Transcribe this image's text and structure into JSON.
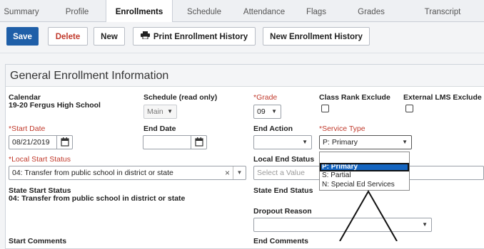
{
  "tabs": [
    {
      "label": "Summary",
      "active": false
    },
    {
      "label": "Profile",
      "active": false
    },
    {
      "label": "Enrollments",
      "active": true
    },
    {
      "label": "Schedule",
      "active": false
    },
    {
      "label": "Attendance",
      "active": false
    },
    {
      "label": "Flags",
      "active": false
    },
    {
      "label": "Grades",
      "active": false
    },
    {
      "label": "Transcript",
      "active": false
    }
  ],
  "toolbar": {
    "save": "Save",
    "delete": "Delete",
    "new": "New",
    "print": "Print Enrollment History",
    "new_history": "New Enrollment History"
  },
  "panel": {
    "title": "General Enrollment Information",
    "calendar": {
      "label": "Calendar",
      "value": "19-20 Fergus High School"
    },
    "schedule": {
      "label": "Schedule (read only)",
      "value": "Main"
    },
    "grade": {
      "label": "*Grade",
      "value": "09"
    },
    "class_rank": {
      "label": "Class Rank Exclude"
    },
    "external_lms": {
      "label": "External LMS Exclude"
    },
    "start_date": {
      "label": "*Start Date",
      "value": "08/21/2019"
    },
    "end_date": {
      "label": "End Date",
      "value": ""
    },
    "end_action": {
      "label": "End Action",
      "value": ""
    },
    "service_type": {
      "label": "*Service Type",
      "value": "P: Primary",
      "options": [
        "P: Primary",
        "S: Partial",
        "N: Special Ed Services"
      ],
      "selected_index": 0
    },
    "local_start_status": {
      "label": "*Local Start Status",
      "value": "04: Transfer from public school in district or state",
      "clear": "×"
    },
    "local_end_status": {
      "label": "Local End Status",
      "placeholder": "Select a Value"
    },
    "state_start_status": {
      "label": "State Start Status",
      "value": "04: Transfer from public school in district or state"
    },
    "state_end_status": {
      "label": "State End Status"
    },
    "dropout_reason": {
      "label": "Dropout Reason",
      "value": ""
    },
    "start_comments": {
      "label": "Start Comments"
    },
    "end_comments": {
      "label": "End Comments"
    }
  },
  "colors": {
    "primary": "#1f5fa8",
    "required": "#c0392b",
    "highlight": "#1565c0"
  }
}
